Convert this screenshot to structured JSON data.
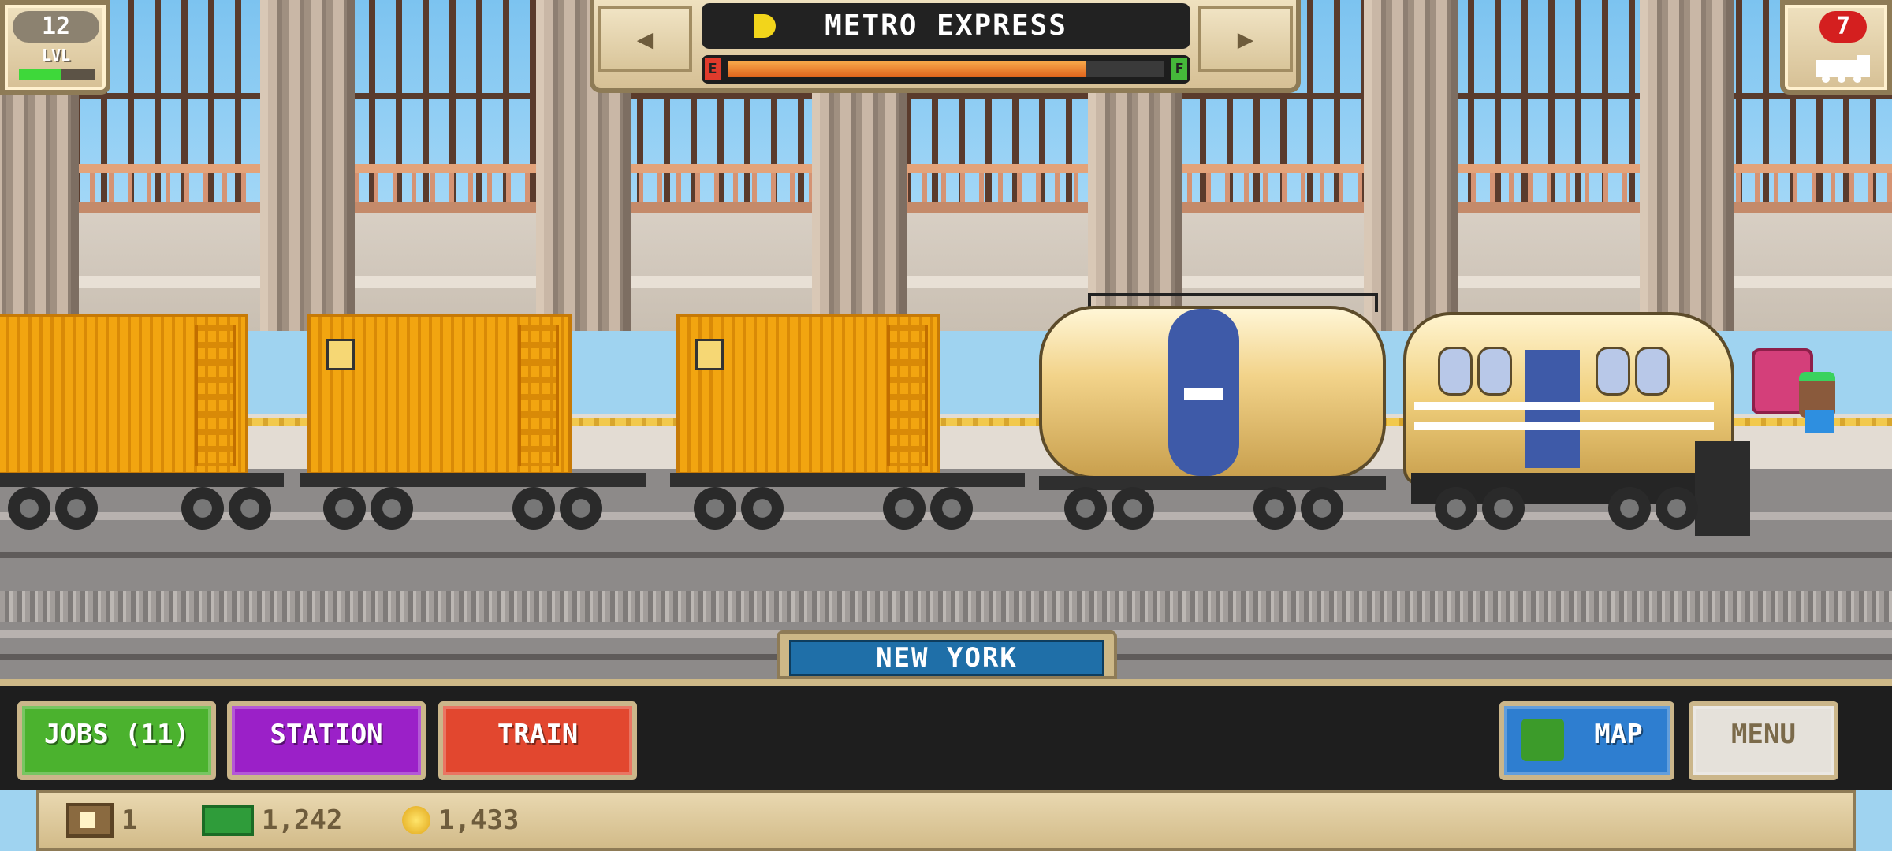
{
  "hud": {
    "level_number": "12",
    "level_label": "LVL",
    "level_progress": 0.55,
    "trains_count": "7"
  },
  "train_title": {
    "name": "METRO EXPRESS",
    "prev_icon": "triangle-left",
    "next_icon": "triangle-right",
    "fuel_empty_label": "E",
    "fuel_full_label": "F",
    "fuel_level": 0.82
  },
  "location": {
    "city": "NEW YORK"
  },
  "toolbar": {
    "jobs_label": "JOBS (11)",
    "station_label": "STATION",
    "train_label": "TRAIN",
    "map_label": "MAP",
    "menu_label": "MENU"
  },
  "resources": {
    "crates": "1",
    "cash": "1,242",
    "coins": "1,433"
  },
  "colors": {
    "jobs": "#4bb22e",
    "station": "#9b20c8",
    "train": "#e2472f",
    "map": "#2e7ed0",
    "menu": "#e5e1da",
    "city_label": "#1f6fa8",
    "badge": "#d41f1f"
  }
}
